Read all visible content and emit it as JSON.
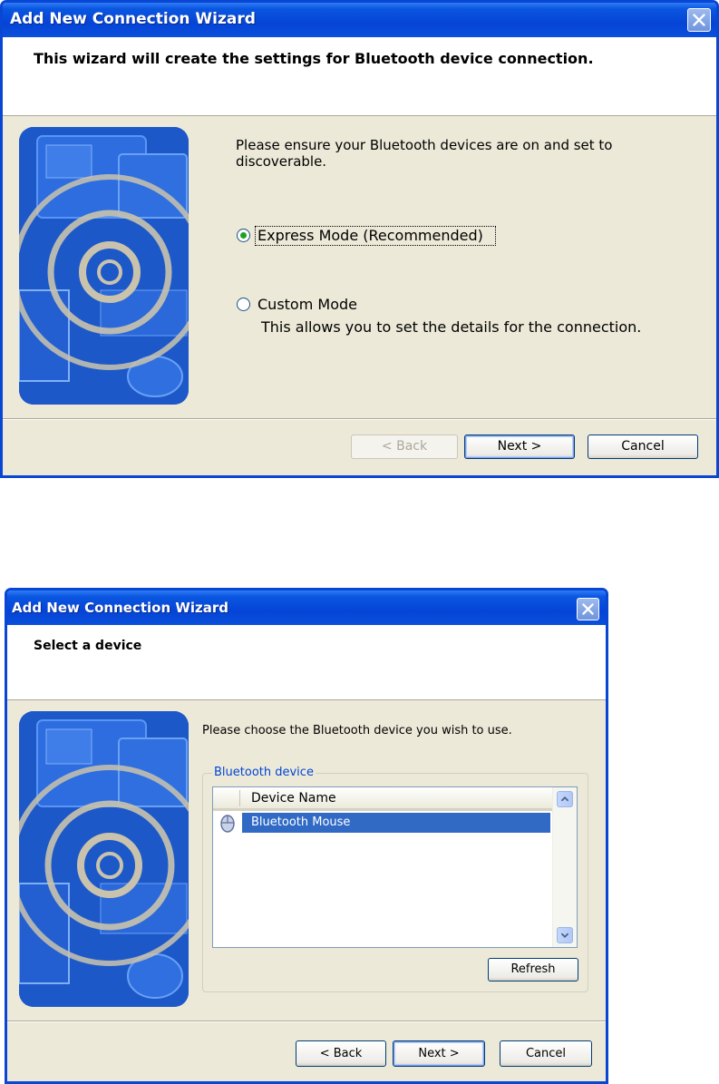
{
  "wizard1": {
    "title": "Add New Connection Wizard",
    "header": "This wizard will create the settings for Bluetooth device connection.",
    "instruction_line1": "Please ensure your Bluetooth devices are on and set to",
    "instruction_line2": "discoverable.",
    "option_express": "Express Mode (Recommended)",
    "option_express_selected": true,
    "option_custom": "Custom Mode",
    "option_custom_desc": "This allows you to set the details for the connection.",
    "back_label": "< Back",
    "next_label": "Next >",
    "cancel_label": "Cancel"
  },
  "wizard2": {
    "title": "Add New Connection Wizard",
    "header": "Select a device",
    "instruction": "Please choose the Bluetooth device you wish to use.",
    "group_label": "Bluetooth device",
    "column_header": "Device Name",
    "devices": [
      "Bluetooth Mouse"
    ],
    "refresh_label": "Refresh",
    "back_label": "< Back",
    "next_label": "Next >",
    "cancel_label": "Cancel"
  },
  "colors": {
    "titlebar": "#0544d6",
    "dialog_bg": "#ece9d8",
    "selection": "#316ac5",
    "radio_dot": "#21a121"
  },
  "icons": {
    "close": "close-icon",
    "mouse": "mouse-icon",
    "scroll_up": "chevron-up-icon",
    "scroll_down": "chevron-down-icon"
  }
}
